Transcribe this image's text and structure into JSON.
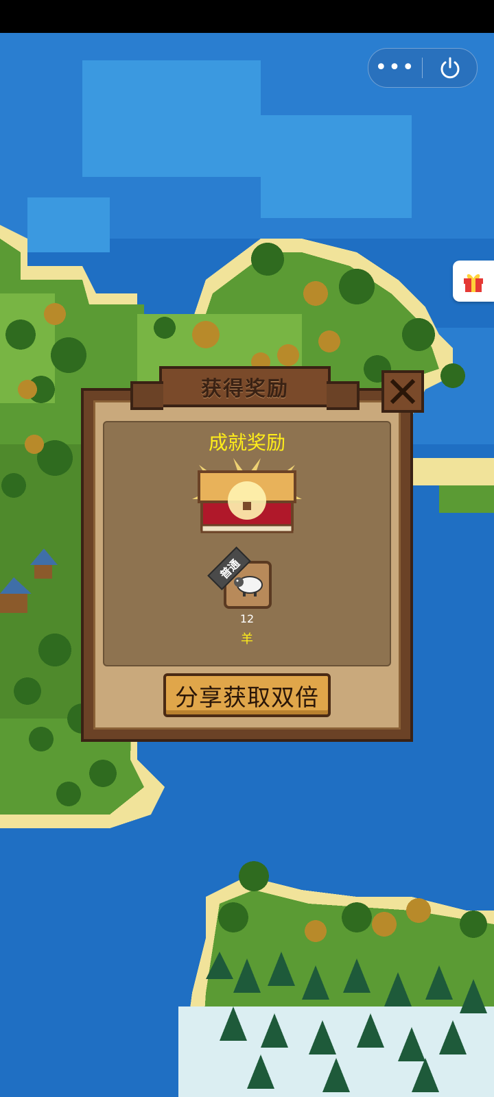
{
  "topbar": {},
  "capsule": {
    "more_icon": "ellipsis-icon",
    "exit_icon": "power-icon"
  },
  "side": {
    "gift_icon": "gift-icon"
  },
  "dialog": {
    "title": "获得奖励",
    "close_icon": "close-x-icon",
    "subtitle": "成就奖励",
    "chest_icon": "glowing-treasure-chest-icon",
    "item": {
      "rarity": "普通",
      "icon": "sheep-icon",
      "count": "12",
      "name": "羊"
    },
    "share_button": "分享获取双倍"
  },
  "colors": {
    "ocean": "#1f6fc3",
    "grass": "#5b9b34",
    "dialog_wood": "#6b4226",
    "dialog_panel": "#c9a97c",
    "gold_text": "#ffee1a",
    "button": "#e0a64a"
  }
}
